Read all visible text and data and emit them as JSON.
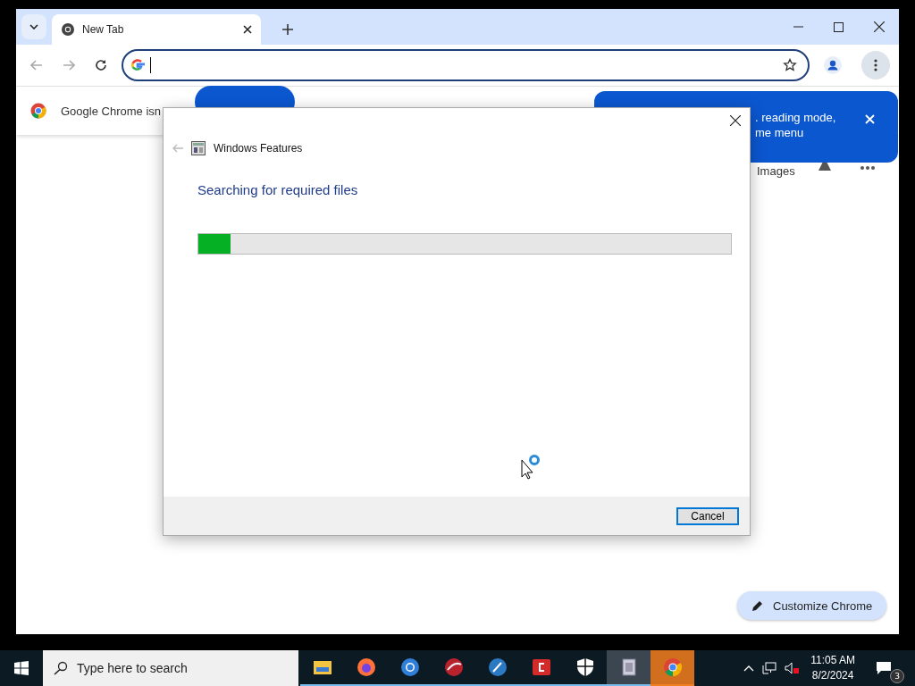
{
  "browser": {
    "tabs": [
      {
        "title": "New Tab",
        "selected": true
      }
    ],
    "infobar": {
      "message": "Google Chrome isn"
    },
    "promo": {
      "lines": [
        ". reading mode,",
        "me menu"
      ]
    },
    "ntp": {
      "images_link": "Images",
      "customize_button": "Customize Chrome"
    }
  },
  "dialog": {
    "title": "Windows Features",
    "heading": "Searching for required files",
    "progress": {
      "level": 0.06
    },
    "buttons": [
      {
        "label": "Cancel",
        "default": true
      }
    ]
  },
  "taskbar": {
    "search": {
      "placeholder": "Type here to search"
    },
    "apps": [
      {
        "kind": "folder",
        "selected": false,
        "flashing": false
      },
      {
        "kind": "firefox",
        "selected": false,
        "flashing": false
      },
      {
        "kind": "ring",
        "selected": false,
        "flashing": false
      },
      {
        "kind": "redball",
        "selected": false,
        "flashing": false
      },
      {
        "kind": "blueball",
        "selected": false,
        "flashing": false
      },
      {
        "kind": "redbox",
        "selected": false,
        "flashing": false
      },
      {
        "kind": "shield",
        "selected": false,
        "flashing": false
      },
      {
        "kind": "features",
        "selected": true,
        "flashing": false
      },
      {
        "kind": "chrome",
        "selected": false,
        "flashing": true
      }
    ],
    "time": "11:05 AM",
    "date": "8/2/2024",
    "notifications": "3"
  }
}
